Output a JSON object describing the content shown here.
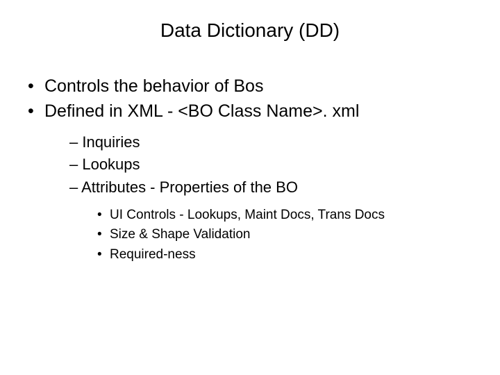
{
  "title": "Data Dictionary (DD)",
  "bullets": {
    "b1": "Controls the behavior of Bos",
    "b2": "Defined in XML - <BO Class Name>. xml",
    "sub": {
      "s1": "– Inquiries",
      "s2": "– Lookups",
      "s3": "– Attributes - Properties of the BO",
      "subsub": {
        "ss1": "UI Controls - Lookups, Maint Docs, Trans Docs",
        "ss2": "Size & Shape Validation",
        "ss3": "Required-ness"
      }
    }
  }
}
